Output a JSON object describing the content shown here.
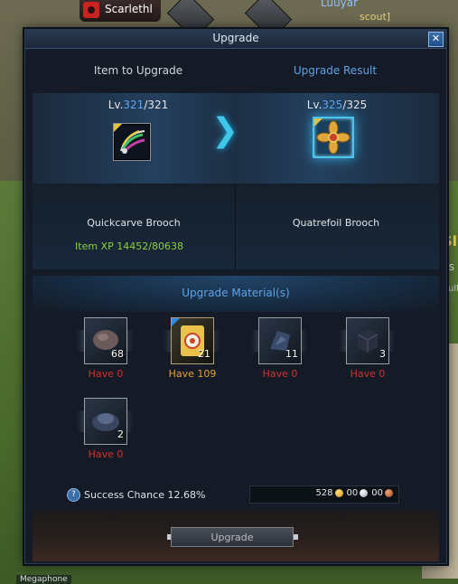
{
  "hud": {
    "player_name": "Scarlethl",
    "other_name": "Luuyar",
    "other_tag": "scout]",
    "side_text_1": "Sli",
    "side_text_2": "ies",
    "side_text_3": "ulti]",
    "bottom_tag": "Megaphone"
  },
  "window": {
    "title": "Upgrade",
    "close_label": "✕",
    "left_header": "Item to Upgrade",
    "right_header": "Upgrade Result",
    "left_item": {
      "level_prefix": "Lv.",
      "level_current": "321",
      "level_max": "/321",
      "name": "Quickcarve Brooch",
      "xp": "Item XP 14452/80638"
    },
    "right_item": {
      "level_prefix": "Lv.",
      "level_current": "325",
      "level_max": "/325",
      "name": "Quatrefoil Brooch"
    },
    "arrow_glyph": "❯",
    "materials_title": "Upgrade Material(s)",
    "materials": [
      {
        "count": "68",
        "have": "Have 0",
        "status": "red",
        "icon": "ore-stone-icon"
      },
      {
        "count": "21",
        "have": "Have 109",
        "status": "orange",
        "icon": "scroll-icon"
      },
      {
        "count": "11",
        "have": "Have 0",
        "status": "red",
        "icon": "fragment-icon"
      },
      {
        "count": "3",
        "have": "Have 0",
        "status": "red",
        "icon": "cube-icon"
      },
      {
        "count": "2",
        "have": "Have 0",
        "status": "red",
        "icon": "shell-icon"
      }
    ],
    "success": {
      "help": "?",
      "text": "Success Chance 12.68%"
    },
    "cost": {
      "gold": "528",
      "silver": "00",
      "copper": "00"
    },
    "upgrade_button": "Upgrade"
  },
  "colors": {
    "accent_blue": "#5ea2e6",
    "xp_green": "#8ccf3e",
    "insufficient_red": "#d2322e",
    "available_orange": "#e8a23a"
  }
}
